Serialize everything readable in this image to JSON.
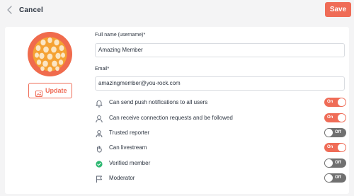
{
  "header": {
    "cancel_label": "Cancel",
    "save_label": "Save"
  },
  "profile": {
    "update_label": "Update"
  },
  "form": {
    "fullname_label": "Full name (username)*",
    "fullname_value": "Amazing Member",
    "email_label": "Email*",
    "email_value": "amazingmember@you-rock.com"
  },
  "permissions": [
    {
      "label": "Can send push notifications to all users",
      "state": "On",
      "icon": "bell-icon"
    },
    {
      "label": "Can receive connection requests and be followed",
      "state": "On",
      "icon": "user-icon"
    },
    {
      "label": "Trusted reporter",
      "state": "Off",
      "icon": "user-shield-icon"
    },
    {
      "label": "Can livestream",
      "state": "On",
      "icon": "hand-icon"
    },
    {
      "label": "Verified member",
      "state": "Off",
      "icon": "verified-check-icon"
    },
    {
      "label": "Moderator",
      "state": "Off",
      "icon": "flag-icon"
    }
  ],
  "colors": {
    "accent": "#ef6c57",
    "toggle_off": "#707070",
    "verified": "#2eb872"
  }
}
